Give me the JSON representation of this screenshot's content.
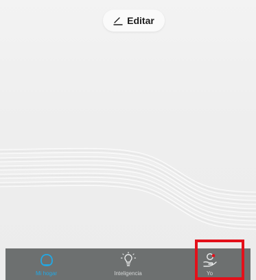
{
  "header": {
    "edit_label": "Editar",
    "edit_icon": "pencil-icon"
  },
  "tabbar": {
    "tabs": [
      {
        "label": "Mi hogar",
        "icon": "home-icon",
        "active": true
      },
      {
        "label": "Inteligencia",
        "icon": "lightbulb-icon",
        "active": false
      },
      {
        "label": "Yo",
        "icon": "user-hand-icon",
        "active": false,
        "has_notification_dot": true
      }
    ]
  },
  "colors": {
    "background": "#eeeeee",
    "tabbar_background": "#6d7070",
    "active_tab": "#21a9e6",
    "inactive_tab": "#d4d6d6",
    "notification_dot": "#e3101a",
    "highlight_box": "#e3101a"
  }
}
